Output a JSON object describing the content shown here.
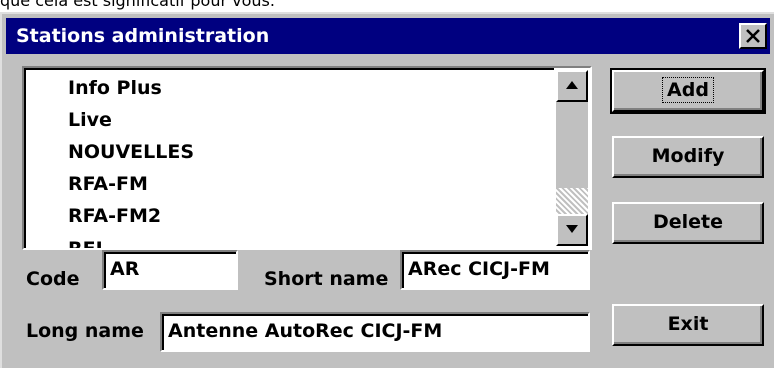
{
  "page_caption": "que cela est significatif pour vous.",
  "window": {
    "title": "Stations administration",
    "close_icon": "close-x-icon"
  },
  "stations_list": {
    "items": [
      "Info Plus",
      "Live",
      "NOUVELLES",
      "RFA-FM",
      "RFA-FM2",
      "RFI ..."
    ],
    "scroll_up_icon": "arrow-up-icon",
    "scroll_down_icon": "arrow-down-icon"
  },
  "buttons": {
    "add": "Add",
    "modify": "Modify",
    "delete": "Delete",
    "exit": "Exit"
  },
  "form": {
    "code_label": "Code",
    "code_value": "AR",
    "short_name_label": "Short name",
    "short_name_value": "ARec CICJ-FM",
    "long_name_label": "Long name",
    "long_name_value": "Antenne AutoRec CICJ-FM"
  },
  "colors": {
    "title_bar": "#000080",
    "dialog_face": "#c0c0c0"
  }
}
